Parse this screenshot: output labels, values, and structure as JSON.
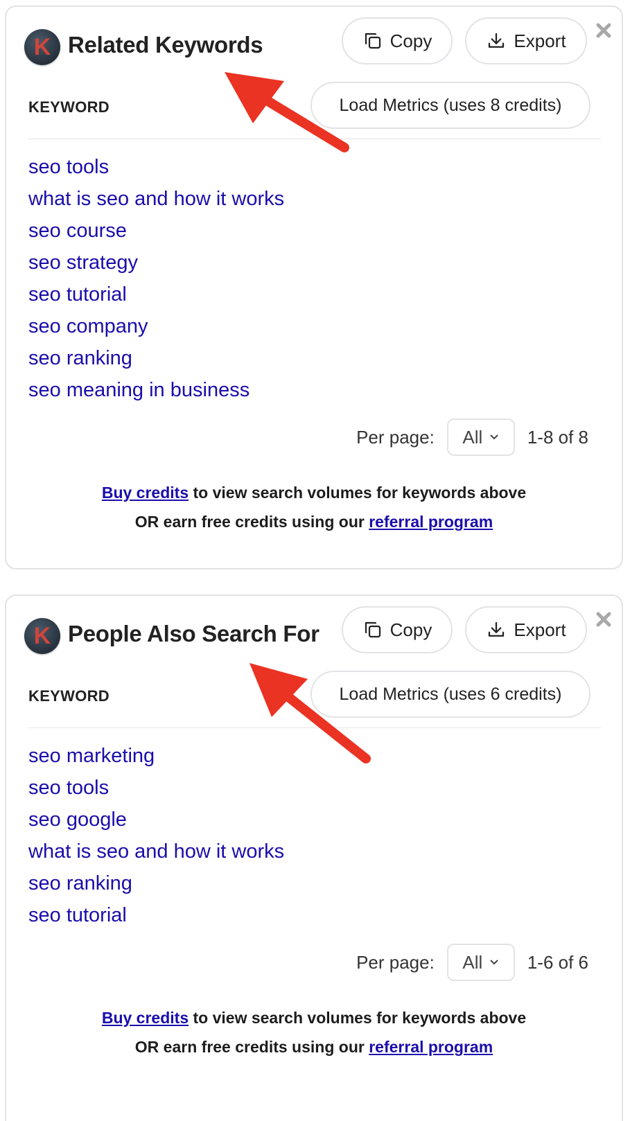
{
  "colors": {
    "accent": "#1a0dab",
    "arrow": "#ea3323",
    "logo_letter": "#d2453a"
  },
  "panels": [
    {
      "logo_letter": "K",
      "title": "Related Keywords",
      "copy_label": "Copy",
      "export_label": "Export",
      "load_metrics_label": "Load Metrics (uses 8 credits)",
      "column_header": "KEYWORD",
      "keywords": [
        "seo tools",
        "what is seo and how it works",
        "seo course",
        "seo strategy",
        "seo tutorial",
        "seo company",
        "seo ranking",
        "seo meaning in business"
      ],
      "per_page_label": "Per page:",
      "per_page_value": "All",
      "range": "1-8 of 8",
      "footer": {
        "buy_link": "Buy credits",
        "line1_rest": " to view search volumes for keywords above",
        "line2_prefix": "OR earn free credits using our ",
        "referral_link": "referral program"
      }
    },
    {
      "logo_letter": "K",
      "title": "People Also Search For",
      "copy_label": "Copy",
      "export_label": "Export",
      "load_metrics_label": "Load Metrics (uses 6 credits)",
      "column_header": "KEYWORD",
      "keywords": [
        "seo marketing",
        "seo tools",
        "seo google",
        "what is seo and how it works",
        "seo ranking",
        "seo tutorial"
      ],
      "per_page_label": "Per page:",
      "per_page_value": "All",
      "range": "1-6 of 6",
      "footer": {
        "buy_link": "Buy credits",
        "line1_rest": " to view search volumes for keywords above",
        "line2_prefix": "OR earn free credits using our ",
        "referral_link": "referral program"
      }
    }
  ]
}
